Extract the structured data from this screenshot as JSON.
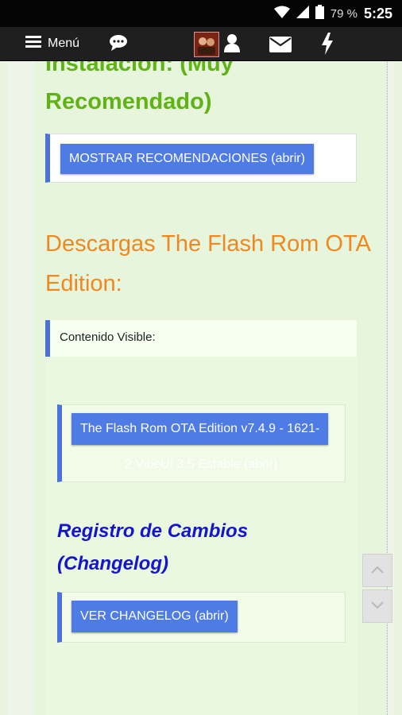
{
  "status_bar": {
    "battery_percent": "79 %",
    "time": "5:25"
  },
  "nav": {
    "menu_label": "Menú"
  },
  "page": {
    "heading_green": "Instalación: (Muy Recomendado)",
    "recommendations_button": "MOSTRAR RECOMENDACIONES (abrir)",
    "heading_downloads": "Descargas The Flash Rom OTA Edition:",
    "visible_content_label": "Contenido Visible:",
    "download_button": "The Flash Rom OTA Edition v7.4.9 - 1621-",
    "download_button_continuation": "2 VibeUI 3.5 Estable (abrir)",
    "changelog_heading": "Registro de Cambios (Changelog)",
    "changelog_button": "VER CHANGELOG (abrir)"
  },
  "colors": {
    "green_heading": "#5fb314",
    "orange_heading": "#f08820",
    "blue_heading": "#1515cc",
    "button_blue": "#4f7be4",
    "accent_border": "#4a72d8"
  }
}
